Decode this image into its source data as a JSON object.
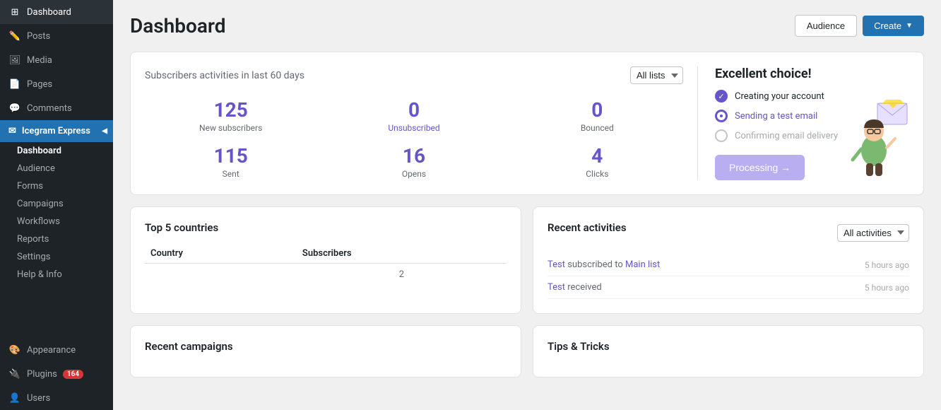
{
  "sidebar": {
    "items": [
      {
        "id": "dashboard",
        "label": "Dashboard",
        "icon": "⊞"
      },
      {
        "id": "posts",
        "label": "Posts",
        "icon": "📝"
      },
      {
        "id": "media",
        "label": "Media",
        "icon": "🖼"
      },
      {
        "id": "pages",
        "label": "Pages",
        "icon": "📄"
      },
      {
        "id": "comments",
        "label": "Comments",
        "icon": "💬"
      }
    ],
    "highlight": {
      "label": "Icegram Express",
      "icon": "✉"
    },
    "sub_items": [
      {
        "id": "dashboard-sub",
        "label": "Dashboard",
        "active": true
      },
      {
        "id": "audience",
        "label": "Audience"
      },
      {
        "id": "forms",
        "label": "Forms"
      },
      {
        "id": "campaigns",
        "label": "Campaigns"
      },
      {
        "id": "workflows",
        "label": "Workflows"
      },
      {
        "id": "reports",
        "label": "Reports"
      },
      {
        "id": "settings",
        "label": "Settings"
      },
      {
        "id": "help-info",
        "label": "Help & Info"
      }
    ],
    "bottom_items": [
      {
        "id": "appearance",
        "label": "Appearance",
        "icon": "🎨"
      },
      {
        "id": "plugins",
        "label": "Plugins",
        "icon": "🔌",
        "badge": "164"
      },
      {
        "id": "users",
        "label": "Users",
        "icon": "👤"
      }
    ]
  },
  "header": {
    "title": "Dashboard",
    "audience_btn": "Audience",
    "create_btn": "Create"
  },
  "stats": {
    "title": "Subscribers activities in last 60 days",
    "filter": "All lists",
    "new_subscribers": {
      "value": "125",
      "label": "New subscribers"
    },
    "unsubscribed": {
      "value": "0",
      "label": "Unsubscribed"
    },
    "bounced": {
      "value": "0",
      "label": "Bounced"
    },
    "sent": {
      "value": "115",
      "label": "Sent"
    },
    "opens": {
      "value": "16",
      "label": "Opens"
    },
    "clicks": {
      "value": "4",
      "label": "Clicks"
    }
  },
  "onboarding": {
    "title": "Excellent choice!",
    "steps": [
      {
        "id": "create-account",
        "label": "Creating your account",
        "status": "done"
      },
      {
        "id": "send-test",
        "label": "Sending a test email",
        "status": "loading"
      },
      {
        "id": "confirm-delivery",
        "label": "Confirming email delivery",
        "status": "empty"
      }
    ],
    "processing_btn": "Processing →"
  },
  "countries": {
    "title": "Top 5 countries",
    "headers": [
      "Country",
      "Subscribers"
    ],
    "rows": [
      {
        "country": "",
        "subscribers": "2"
      }
    ]
  },
  "activities": {
    "title": "Recent activities",
    "filter": "All activities",
    "rows": [
      {
        "text": "subscribed to",
        "link1": "Test",
        "link2": "Main list",
        "time": "5 hours ago"
      },
      {
        "text": "received",
        "link1": "Test",
        "link2": "",
        "time": "5 hours ago"
      }
    ]
  },
  "recent_campaigns": {
    "title": "Recent campaigns"
  },
  "tips": {
    "title": "Tips & Tricks"
  }
}
